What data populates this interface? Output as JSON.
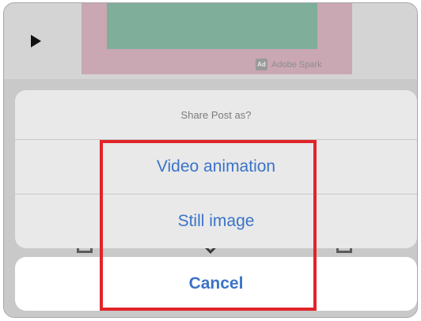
{
  "background": {
    "badge_logo": "Ad",
    "badge_text": "Adobe Spark",
    "play_icon": "play-icon"
  },
  "action_sheet": {
    "title": "Share Post as?",
    "options": [
      {
        "label": "Video animation"
      },
      {
        "label": "Still image"
      }
    ],
    "cancel_label": "Cancel"
  },
  "colors": {
    "action_blue": "#3a73c8",
    "highlight_red": "#e0242a",
    "sheet_bg": "#e9e9e9"
  }
}
